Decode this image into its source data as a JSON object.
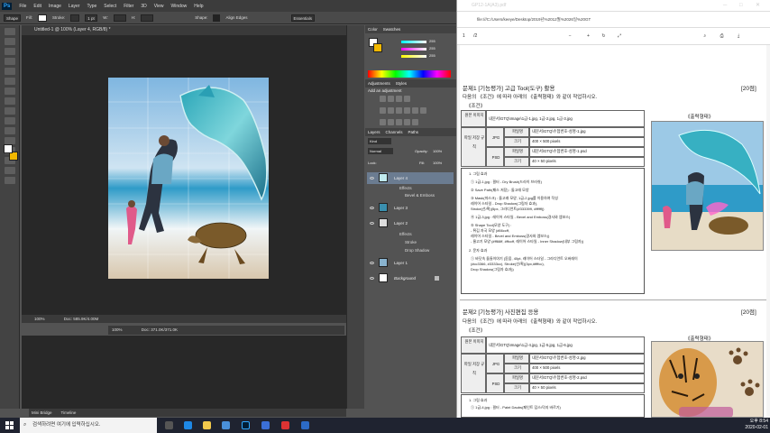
{
  "photoshop": {
    "menu": [
      "File",
      "Edit",
      "Image",
      "Layer",
      "Type",
      "Select",
      "Filter",
      "3D",
      "View",
      "Window",
      "Help"
    ],
    "options": {
      "shape_label": "Shape",
      "fill_label": "Fill:",
      "stroke_label": "Stroke:",
      "stroke_width": "1 pt",
      "w_label": "W:",
      "h_label": "H:",
      "shape_label2": "Shape:",
      "align_edges": "Align Edges",
      "workspace": "Essentials"
    },
    "document": {
      "tab": "Untitled-1 @ 100% (Layer 4, RGB/8) *",
      "zoom": "100%",
      "doc_size": "Doc: 585.9K/4.00M"
    },
    "document2": {
      "zoom": "100%",
      "doc_size": "Doc: 371.0K/371.0K"
    },
    "panels": {
      "color_tabs": [
        "Color",
        "Swatches"
      ],
      "rgb_values": [
        "255",
        "255",
        "255"
      ],
      "adjust_tabs": [
        "Adjustments",
        "Styles"
      ],
      "adjust_title": "Add an adjustment",
      "layers_tabs": [
        "Layers",
        "Channels",
        "Paths"
      ],
      "kind_label": "Kind",
      "blend_mode": "Normal",
      "opacity_label": "Opacity:",
      "opacity_value": "100%",
      "lock_label": "Lock:",
      "fill_label": "Fill:",
      "fill_value": "100%",
      "layers": [
        {
          "name": "Layer 4",
          "effects": [
            "Effects",
            "Bevel & Emboss"
          ]
        },
        {
          "name": "Layer 3",
          "effects": []
        },
        {
          "name": "Layer 2",
          "effects": [
            "Effects",
            "Stroke",
            "Drop Shadow"
          ]
        },
        {
          "name": "Layer 1",
          "effects": []
        },
        {
          "name": "Background",
          "effects": []
        }
      ]
    },
    "bottom_tabs": [
      "Mini Bridge",
      "Timeline"
    ]
  },
  "pdf": {
    "tab_title": "GP12-1A(A3).pdf",
    "url": "file:///C:/Users/keeye/Desktop/2019년%2012월%2026일%20GT",
    "page_num": "1",
    "page_total": "/2",
    "q1": {
      "title": "문제1 [기능평가] 고급 Tool(도구) 활용",
      "points": "[20점]",
      "desc": "다음의 《조건》에 따라 아래의 《출력형태》와 같이 작업하시오.",
      "cond_label": "《조건》",
      "output_label": "《출력형태》",
      "table": {
        "row1": {
          "head": "원본 이미지",
          "value": "내문서\\GTQ\\Image\\1급-1.jpg, 1급-2.jpg, 1급-3.jpg"
        },
        "save_head": "파일 저장 규칙",
        "jpg": {
          "fmt": "JPG",
          "name_label": "파일명",
          "name": "내문서\\GTQ\\수험번호-성명-1.jpg",
          "size_label": "크기",
          "size": "400 × 500 pixels"
        },
        "psd": {
          "fmt": "PSD",
          "name_label": "파일명",
          "name": "내문서\\GTQ\\수험번호-성명-1.psd",
          "size_label": "크기",
          "size": "40 × 50 pixels"
        }
      },
      "lines": [
        "1. 그림 효과",
        "① 1급-1.jpg : 필터 - Dry Brush(드라이 브러쉬)",
        "② Save Path(패스 저장) : 돌고래 모양",
        "③ Mask(마스크) : 돌고래 모양, 1급-2.jpg를 이용하여 작성",
        "   레이어 스타일 - Drop Shadow(그림자 효과),",
        "   Stroke(선/획)(5px, 그라디언트(#333399, #ffffff))",
        "④ 1급-3.jpg : 레이어 스타일 - Bevel and Emboss(경사와 엠보스)",
        "⑤ Shape Tool(모양 도구) :",
        "  - 튀김 자국 모양 (#66ccff,",
        "    레이어 스타일 - Bevel and Emboss(경사와 엠보스))",
        "  - 물고기 모양 (#ff66ff, #ffccff, 레이어 스타일 - Inner Shadow(내부 그림자))",
        "2. 문자 효과",
        "① 바닷속 돌들이야기 (돋움, 40pt, 레이어 스타일 - 그라디언트 오버레이",
        "   (#cc3366, #3333cc), Stroke(선/획)(3px,#ffffcc),",
        "   Drop Shadow(그림자 효과))"
      ]
    },
    "q2": {
      "title": "문제2 [기능평가] 사진편집 응용",
      "points": "[20점]",
      "desc": "다음의 《조건》에 따라 아래의 《출력형태》와 같이 작업하시오.",
      "cond_label": "《조건》",
      "output_label": "《출력형태》",
      "table": {
        "row1": {
          "head": "원본 이미지",
          "value": "내문서\\GTQ\\Image\\1급-4.jpg, 1급-5.jpg, 1급-6.jpg"
        },
        "save_head": "파일 저장 규칙",
        "jpg": {
          "fmt": "JPG",
          "name_label": "파일명",
          "name": "내문서\\GTQ\\수험번호-성명-2.jpg",
          "size_label": "크기",
          "size": "400 × 500 pixels"
        },
        "psd": {
          "fmt": "PSD",
          "name_label": "파일명",
          "name": "내문서\\GTQ\\수험번호-성명-2.psd",
          "size_label": "크기",
          "size": "40 × 50 pixels"
        }
      },
      "lines": [
        "1. 그림 효과",
        "① 1급-4.jpg : 필터 - Paint Daubs(페인트 덥스/덕지 바르기)"
      ]
    }
  },
  "taskbar": {
    "search_placeholder": "검색하려면 여기에 입력하십시오.",
    "time": "오후 8:54",
    "date": "2020-02-01"
  },
  "colors": {
    "ps_bg": "#535353",
    "ps_dark": "#282828",
    "accent_ps": "#31a8ff",
    "bg_swatch": "#f2b800"
  }
}
